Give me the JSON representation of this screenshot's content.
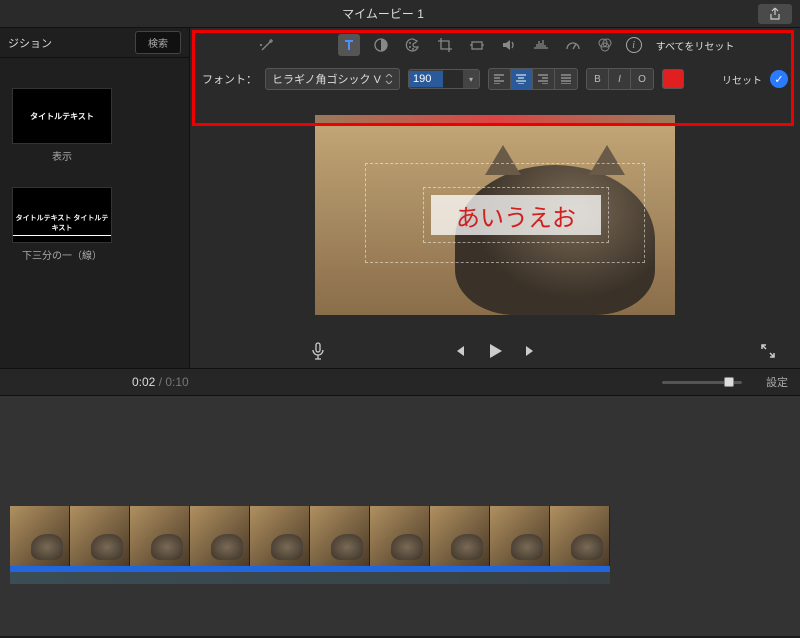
{
  "titlebar": {
    "project_name": "マイムービー 1"
  },
  "sidebar": {
    "tab_transitions": "ジション",
    "search_label": "検索",
    "thumbs": [
      {
        "label": "表示",
        "thumb_text": "タイトルテキスト"
      },
      {
        "label": "下三分の一（線）",
        "thumb_text": "タイトルテキスト\nタイトルテキスト"
      }
    ]
  },
  "inspector": {
    "reset_all": "すべてをリセット"
  },
  "font_bar": {
    "label": "フォント：",
    "font_name": "ヒラギノ角ゴシック V",
    "size_value": "190",
    "bold": "B",
    "italic": "I",
    "outline": "O",
    "reset": "リセット"
  },
  "preview": {
    "title_text": "あいうえお"
  },
  "timecode": {
    "current": "0:02",
    "total": "0:10"
  },
  "settings": {
    "label": "設定"
  }
}
